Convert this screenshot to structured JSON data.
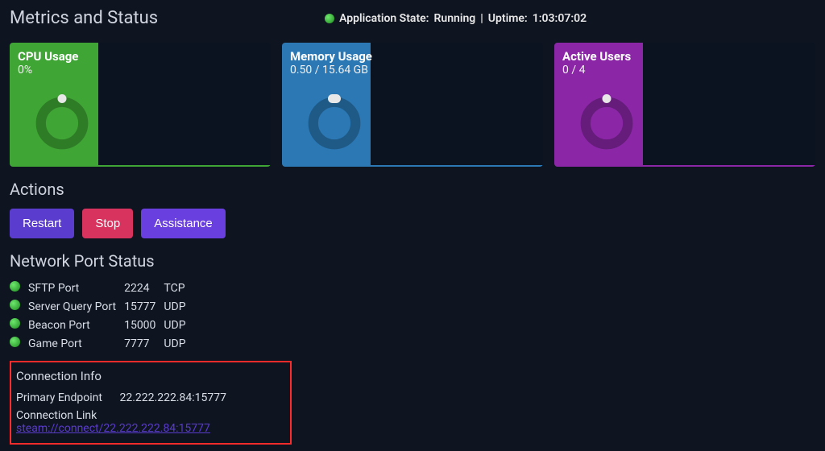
{
  "header": {
    "title": "Metrics and Status",
    "state_label": "Application State:",
    "state_value": "Running",
    "uptime_label": "Uptime:",
    "uptime_value": "1:03:07:02"
  },
  "cards": {
    "cpu": {
      "title": "CPU Usage",
      "value": "0%"
    },
    "mem": {
      "title": "Memory Usage",
      "value": "0.50 / 15.64 GB"
    },
    "users": {
      "title": "Active Users",
      "value": "0 / 4"
    }
  },
  "actions": {
    "heading": "Actions",
    "restart": "Restart",
    "stop": "Stop",
    "assist": "Assistance"
  },
  "ports": {
    "heading": "Network Port Status",
    "rows": [
      {
        "name": "SFTP Port",
        "port": "2224",
        "proto": "TCP"
      },
      {
        "name": "Server Query Port",
        "port": "15777",
        "proto": "UDP"
      },
      {
        "name": "Beacon Port",
        "port": "15000",
        "proto": "UDP"
      },
      {
        "name": "Game Port",
        "port": "7777",
        "proto": "UDP"
      }
    ]
  },
  "conn": {
    "heading": "Connection Info",
    "endpoint_label": "Primary Endpoint",
    "endpoint_value": "22.222.222.84:15777",
    "link_label": "Connection Link",
    "link_value": "steam://connect/22.222.222.84:15777"
  },
  "colors": {
    "green": "#3fa535",
    "blue": "#2b78b5",
    "purple": "#8b27a7"
  }
}
